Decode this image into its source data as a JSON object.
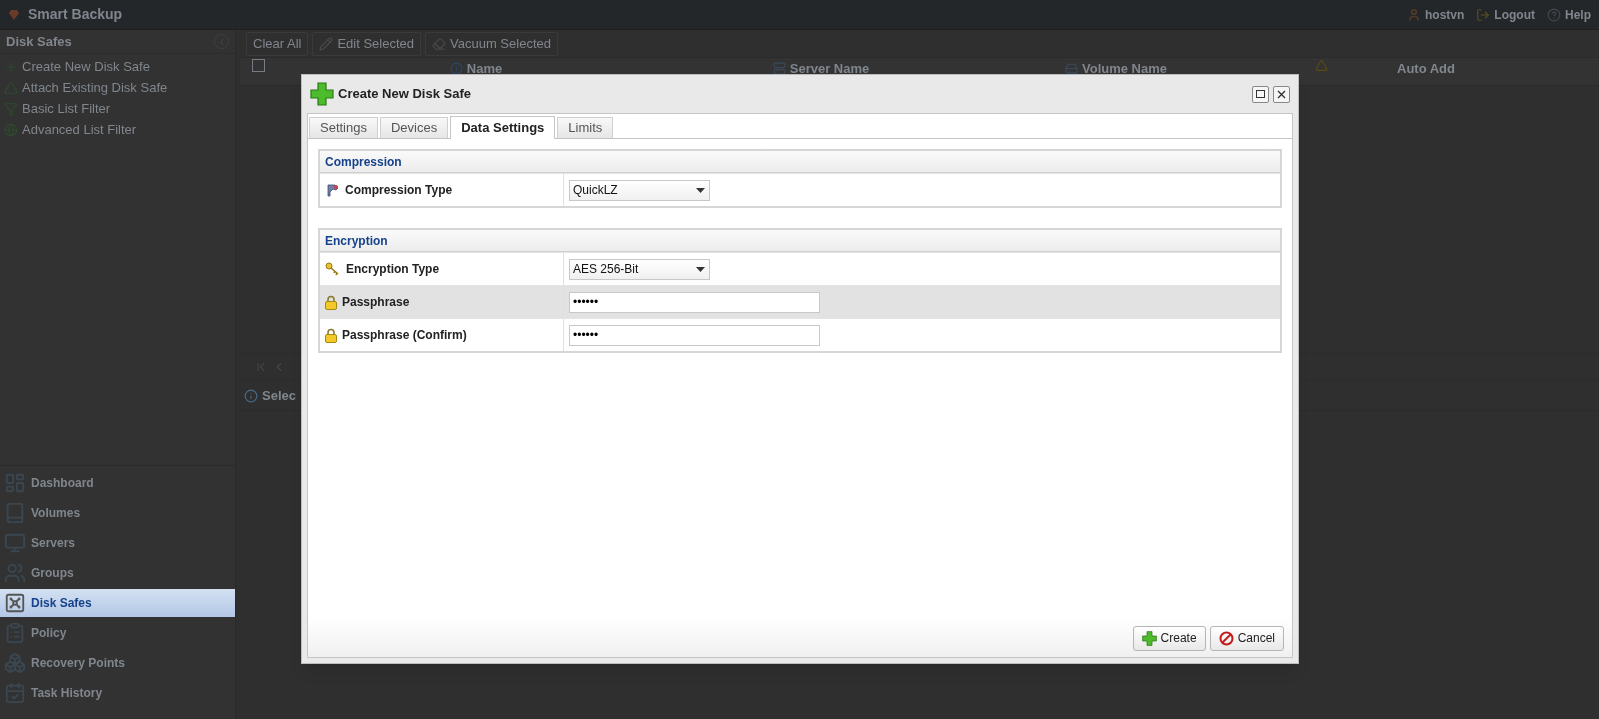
{
  "app": {
    "title": "Smart Backup",
    "user": "hostvn",
    "logout": "Logout",
    "help": "Help"
  },
  "sidebar": {
    "title": "Disk Safes",
    "actions": [
      "Create New Disk Safe",
      "Attach Existing Disk Safe",
      "Basic List Filter",
      "Advanced List Filter"
    ],
    "nav": [
      {
        "label": "Dashboard",
        "selected": false
      },
      {
        "label": "Volumes",
        "selected": false
      },
      {
        "label": "Servers",
        "selected": false
      },
      {
        "label": "Groups",
        "selected": false
      },
      {
        "label": "Disk Safes",
        "selected": true
      },
      {
        "label": "Policy",
        "selected": false
      },
      {
        "label": "Recovery Points",
        "selected": false
      },
      {
        "label": "Task History",
        "selected": false
      }
    ]
  },
  "toolbar": {
    "buttons": [
      "Clear All",
      "Edit Selected",
      "Vacuum Selected"
    ]
  },
  "grid": {
    "select_all": {
      "checked": false
    },
    "columns": [
      "Name",
      "Server Name",
      "Volume Name",
      "Auto Add"
    ]
  },
  "details": {
    "title": "Selec"
  },
  "dialog": {
    "title": "Create New Disk Safe",
    "tabs": [
      {
        "label": "Settings",
        "selected": false
      },
      {
        "label": "Devices",
        "selected": false
      },
      {
        "label": "Data Settings",
        "selected": true
      },
      {
        "label": "Limits",
        "selected": false
      }
    ],
    "sections": [
      {
        "title": "Compression",
        "rows": [
          {
            "kind": "select",
            "label": "Compression Type",
            "value": "QuickLZ",
            "selected": false
          }
        ]
      },
      {
        "title": "Encryption",
        "rows": [
          {
            "kind": "select",
            "label": "Encryption Type",
            "value": "AES 256-Bit",
            "selected": false
          },
          {
            "kind": "password",
            "label": "Passphrase",
            "value": "••••••",
            "selected": true
          },
          {
            "kind": "password",
            "label": "Passphrase (Confirm)",
            "value": "••••••",
            "selected": false
          }
        ]
      }
    ],
    "buttons": [
      {
        "kind": "create",
        "label": "Create"
      },
      {
        "kind": "cancel",
        "label": "Cancel"
      }
    ]
  }
}
